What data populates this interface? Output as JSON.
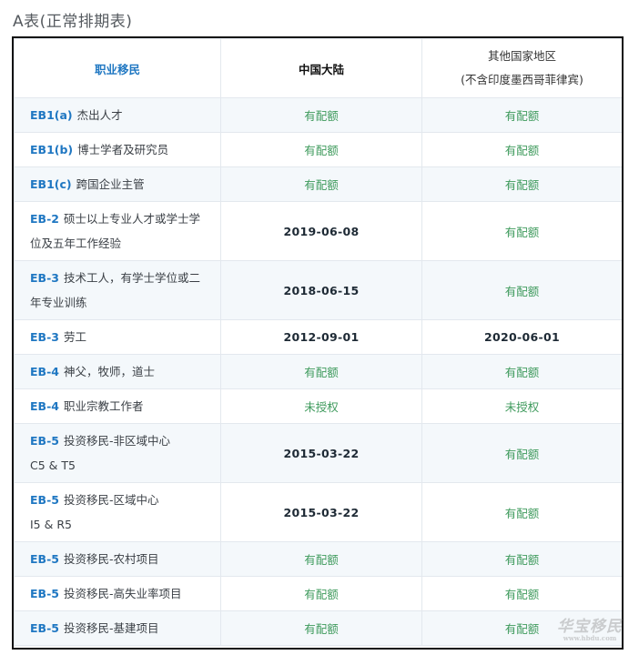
{
  "title": "A表(正常排期表)",
  "headers": {
    "col1": "职业移民",
    "col2": "中国大陆",
    "col3_line1": "其他国家地区",
    "col3_line2": "(不含印度墨西哥菲律宾)"
  },
  "rows": [
    {
      "code": "EB1(a)",
      "desc": "杰出人才",
      "china": "有配额",
      "other": "有配额"
    },
    {
      "code": "EB1(b)",
      "desc": "博士学者及研究员",
      "china": "有配额",
      "other": "有配额"
    },
    {
      "code": "EB1(c)",
      "desc": "跨国企业主管",
      "china": "有配额",
      "other": "有配额"
    },
    {
      "code": "EB-2",
      "desc": "硕士以上专业人才或学士学位及五年工作经验",
      "china": "2019-06-08",
      "other": "有配额"
    },
    {
      "code": "EB-3",
      "desc": "技术工人，有学士学位或二年专业训练",
      "china": "2018-06-15",
      "other": "有配额"
    },
    {
      "code": "EB-3",
      "desc": "劳工",
      "china": "2012-09-01",
      "other": "2020-06-01"
    },
    {
      "code": "EB-4",
      "desc": "神父，牧师，道士",
      "china": "有配额",
      "other": "有配额"
    },
    {
      "code": "EB-4",
      "desc": "职业宗教工作者",
      "china": "未授权",
      "other": "未授权"
    },
    {
      "code": "EB-5",
      "desc": "投资移民-非区域中心",
      "desc2": "C5 & T5",
      "china": "2015-03-22",
      "other": "有配额"
    },
    {
      "code": "EB-5",
      "desc": "投资移民-区域中心",
      "desc2": "I5 & R5",
      "china": "2015-03-22",
      "other": "有配额"
    },
    {
      "code": "EB-5",
      "desc": "投资移民-农村项目",
      "china": "有配额",
      "other": "有配额"
    },
    {
      "code": "EB-5",
      "desc": "投资移民-高失业率项目",
      "china": "有配额",
      "other": "有配额"
    },
    {
      "code": "EB-5",
      "desc": "投资移民-基建项目",
      "china": "有配额",
      "other": "有配额"
    }
  ],
  "watermark": {
    "text": "华宝移民",
    "small": "www.hbdu.com"
  }
}
